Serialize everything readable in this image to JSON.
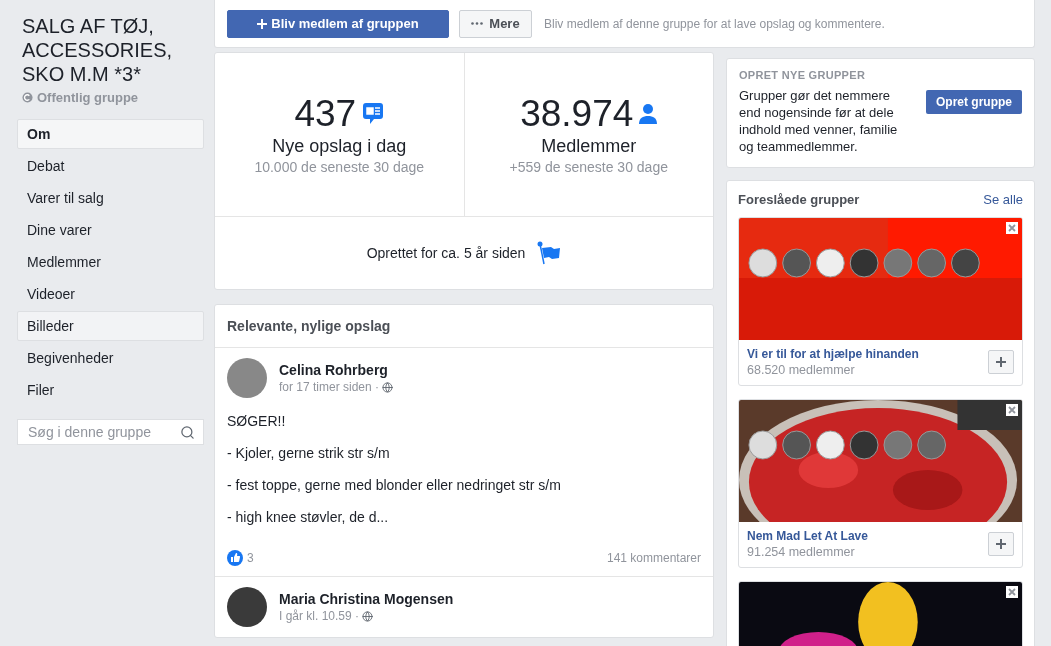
{
  "group": {
    "title": "SALG AF TØJ, ACCESSORIES, SKO M.M *3*",
    "privacy": "Offentlig gruppe"
  },
  "sidebar": {
    "items": [
      {
        "label": "Om",
        "selected": true,
        "hovered": false
      },
      {
        "label": "Debat",
        "selected": false,
        "hovered": false
      },
      {
        "label": "Varer til salg",
        "selected": false,
        "hovered": false
      },
      {
        "label": "Dine varer",
        "selected": false,
        "hovered": false
      },
      {
        "label": "Medlemmer",
        "selected": false,
        "hovered": false
      },
      {
        "label": "Videoer",
        "selected": false,
        "hovered": false
      },
      {
        "label": "Billeder",
        "selected": false,
        "hovered": true
      },
      {
        "label": "Begivenheder",
        "selected": false,
        "hovered": false
      },
      {
        "label": "Filer",
        "selected": false,
        "hovered": false
      }
    ],
    "search": {
      "placeholder": "Søg i denne gruppe"
    }
  },
  "action_bar": {
    "join_button": "Bliv medlem af gruppen",
    "more_button": "Mere",
    "hint": "Bliv medlem af denne gruppe for at lave opslag og kommentere."
  },
  "stats": [
    {
      "kind": "posts",
      "value": "437",
      "label": "Nye opslag i dag",
      "sub": "10.000 de seneste 30 dage"
    },
    {
      "kind": "members",
      "value": "38.974",
      "label": "Medlemmer",
      "sub": "+559 de seneste 30 dage"
    }
  ],
  "created": "Oprettet for ca. 5 år siden",
  "feed": {
    "title": "Relevante, nylige opslag",
    "posts": [
      {
        "author": "Celina Rohrberg",
        "time": "for 17 timer siden ·",
        "paragraphs": [
          "SØGER!!",
          "- Kjoler, gerne strik str s/m",
          "- fest toppe, gerne med blonder eller nedringet str s/m",
          "- high knee støvler, de d..."
        ],
        "likes": "3",
        "comments": "141 kommentarer"
      },
      {
        "author": "Maria Christina Mogensen",
        "time": "I går kl. 10.59 ·"
      }
    ]
  },
  "create_groups": {
    "heading": "OPRET NYE GRUPPER",
    "text": "Grupper gør det nemmere end nogensinde før at dele indhold med venner, familie og teammedlemmer.",
    "button": "Opret gruppe"
  },
  "suggested": {
    "title": "Foreslåede grupper",
    "see_all": "Se alle",
    "groups": [
      {
        "kind": "full",
        "name": "Vi er til for at hjælpe hinanden",
        "members": "68.520 medlemmer"
      },
      {
        "kind": "full",
        "name": "Nem Mad Let At Lave",
        "members": "91.254 medlemmer"
      },
      {
        "kind": "cut"
      }
    ]
  }
}
